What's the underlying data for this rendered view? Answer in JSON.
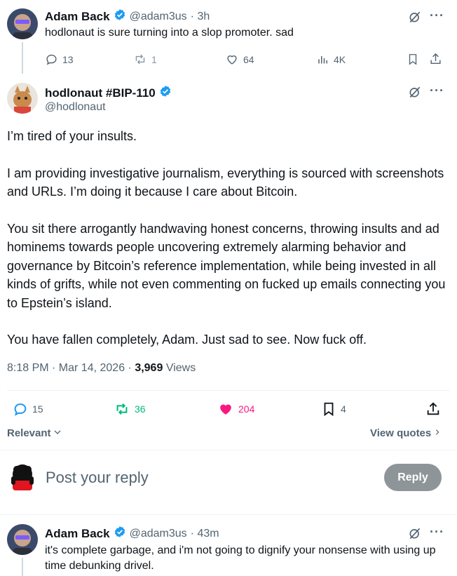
{
  "tweet1": {
    "name": "Adam Back",
    "handle": "@adam3us",
    "time": "· 3h",
    "text": "hodlonaut is sure turning into a slop promoter. sad",
    "replies": "13",
    "reposts": "1",
    "likes": "64",
    "views": "4K"
  },
  "main_tweet": {
    "name": "hodlonaut #BIP-110",
    "handle": "@hodlonaut",
    "paragraphs": [
      "I’m tired of your insults.",
      "I am providing investigative journalism, everything is sourced with screenshots and URLs. I’m doing it because I care about Bitcoin.",
      "You sit there arrogantly handwaving honest concerns, throwing insults and ad hominems towards people uncovering extremely alarming behavior and governance by Bitcoin’s reference implementation, while being invested in all kinds of grifts, while not even commenting on fucked up emails connecting you to Epstein’s island.",
      "You have fallen completely, Adam. Just sad to see. Now fuck off."
    ],
    "time": "8:18 PM · Mar 14, 2026 ·",
    "views_count": "3,969",
    "views_label": "Views",
    "replies": "15",
    "reposts": "36",
    "likes": "204",
    "bookmarks": "4"
  },
  "sort": {
    "relevant": "Relevant",
    "view_quotes": "View quotes"
  },
  "composer": {
    "placeholder": "Post your reply",
    "button": "Reply"
  },
  "reply_tweet": {
    "name": "Adam Back",
    "handle": "@adam3us",
    "time": "· 43m",
    "text": "it's complete garbage, and i'm not going to dignify your nonsense with using up time debunking drivel."
  },
  "colors": {
    "verified": "#1d9bf0",
    "repost_active": "#00ba7c",
    "like_active": "#f91880",
    "muted": "#536471"
  }
}
